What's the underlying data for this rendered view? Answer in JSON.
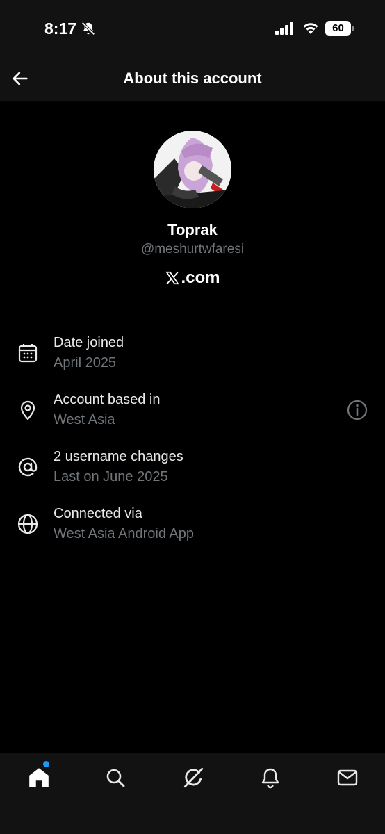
{
  "status_bar": {
    "time": "8:17",
    "battery": "60"
  },
  "header": {
    "title": "About this account"
  },
  "profile": {
    "display_name": "Toprak",
    "handle": "@meshurtwfaresi",
    "domain": ".com"
  },
  "info": [
    {
      "icon": "calendar-icon",
      "title": "Date joined",
      "subtitle": "April 2025"
    },
    {
      "icon": "location-pin-icon",
      "title": "Account based in",
      "subtitle": "West Asia"
    },
    {
      "icon": "at-sign-icon",
      "title": "2 username changes",
      "subtitle": "Last on June 2025"
    },
    {
      "icon": "globe-icon",
      "title": "Connected via",
      "subtitle": "West Asia Android App"
    }
  ],
  "tab_bar": {
    "tabs": [
      "home-icon",
      "search-icon",
      "grok-icon",
      "notifications-icon",
      "messages-icon"
    ],
    "unread_indicator_color": "#1d9bf0"
  },
  "colors": {
    "background": "#000000",
    "bar_background": "#121212",
    "primary_text": "#e7e9ea",
    "secondary_text": "#71767b",
    "accent": "#1d9bf0"
  }
}
